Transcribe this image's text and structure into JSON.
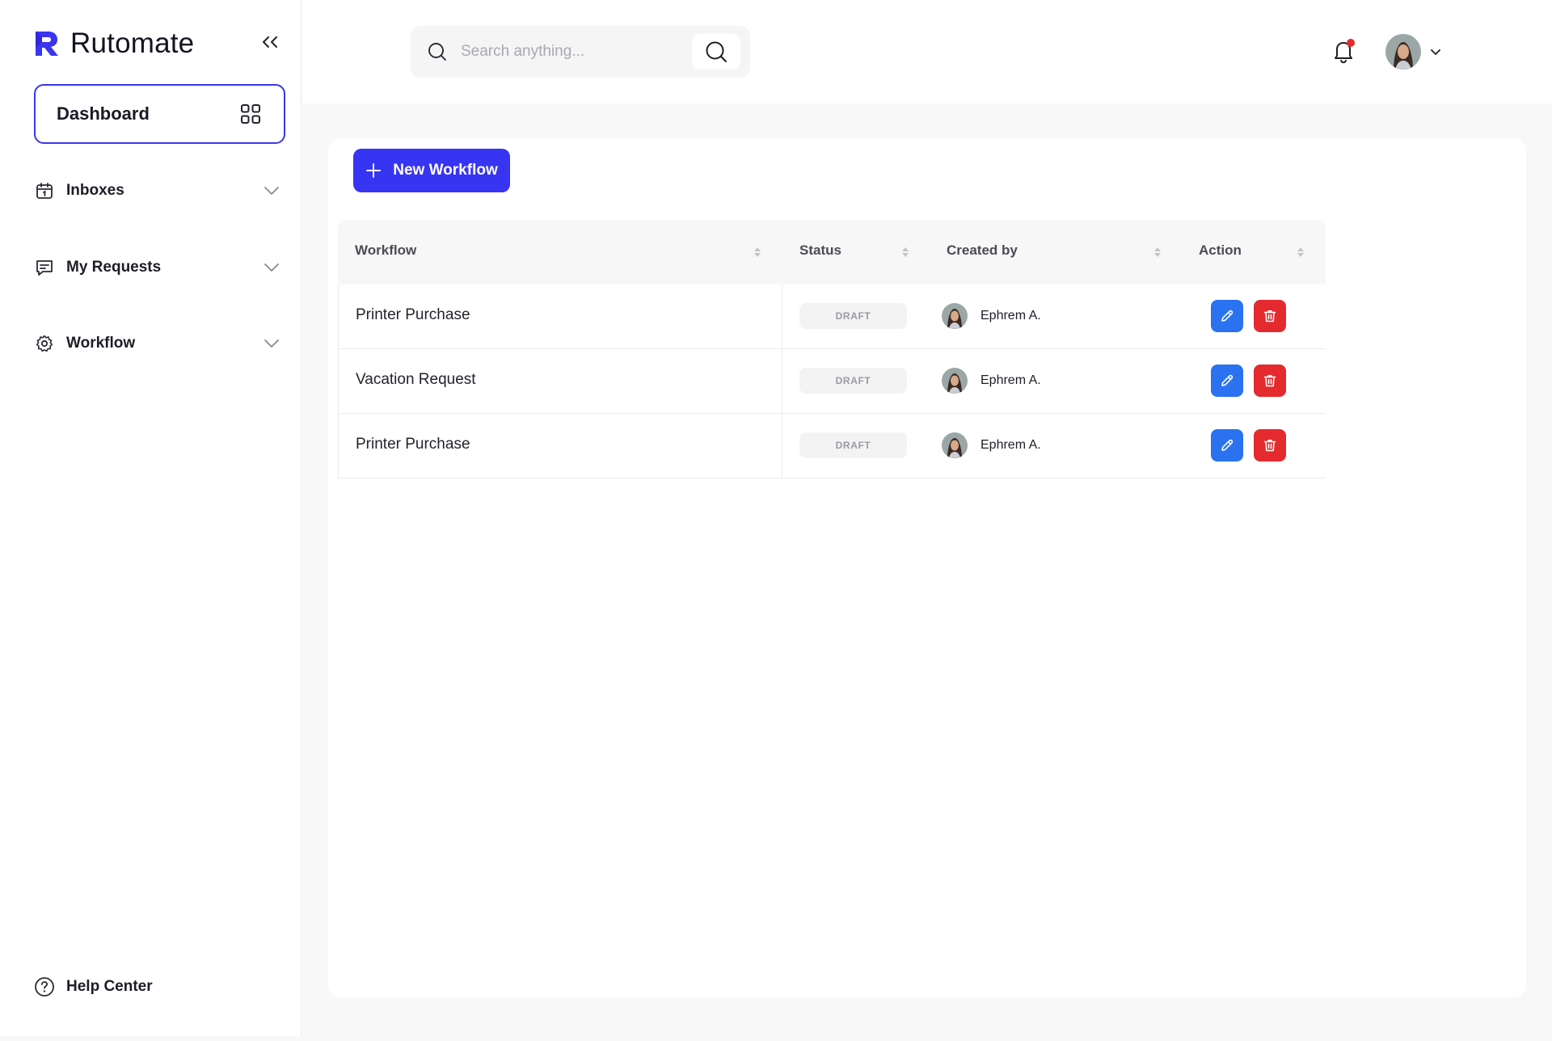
{
  "app": {
    "name": "Rutomate",
    "brand_color": "#3b35f0"
  },
  "sidebar": {
    "dashboard_label": "Dashboard",
    "items": [
      {
        "label": "Inboxes",
        "icon": "calendar-icon"
      },
      {
        "label": "My Requests",
        "icon": "message-icon"
      },
      {
        "label": "Workflow",
        "icon": "gear-icon"
      }
    ],
    "help_label": "Help Center"
  },
  "header": {
    "search_placeholder": "Search anything..."
  },
  "main": {
    "new_button_label": "New Workflow",
    "table": {
      "columns": [
        "Workflow",
        "Status",
        "Created by",
        "Action"
      ],
      "rows": [
        {
          "workflow": "Printer Purchase",
          "status": "DRAFT",
          "created_by": "Ephrem A."
        },
        {
          "workflow": "Vacation Request",
          "status": "DRAFT",
          "created_by": "Ephrem A."
        },
        {
          "workflow": "Printer Purchase",
          "status": "DRAFT",
          "created_by": "Ephrem A."
        }
      ]
    }
  },
  "colors": {
    "edit_button": "#2a72f0",
    "delete_button": "#e42a2e",
    "notification_dot": "#e52a2a"
  }
}
